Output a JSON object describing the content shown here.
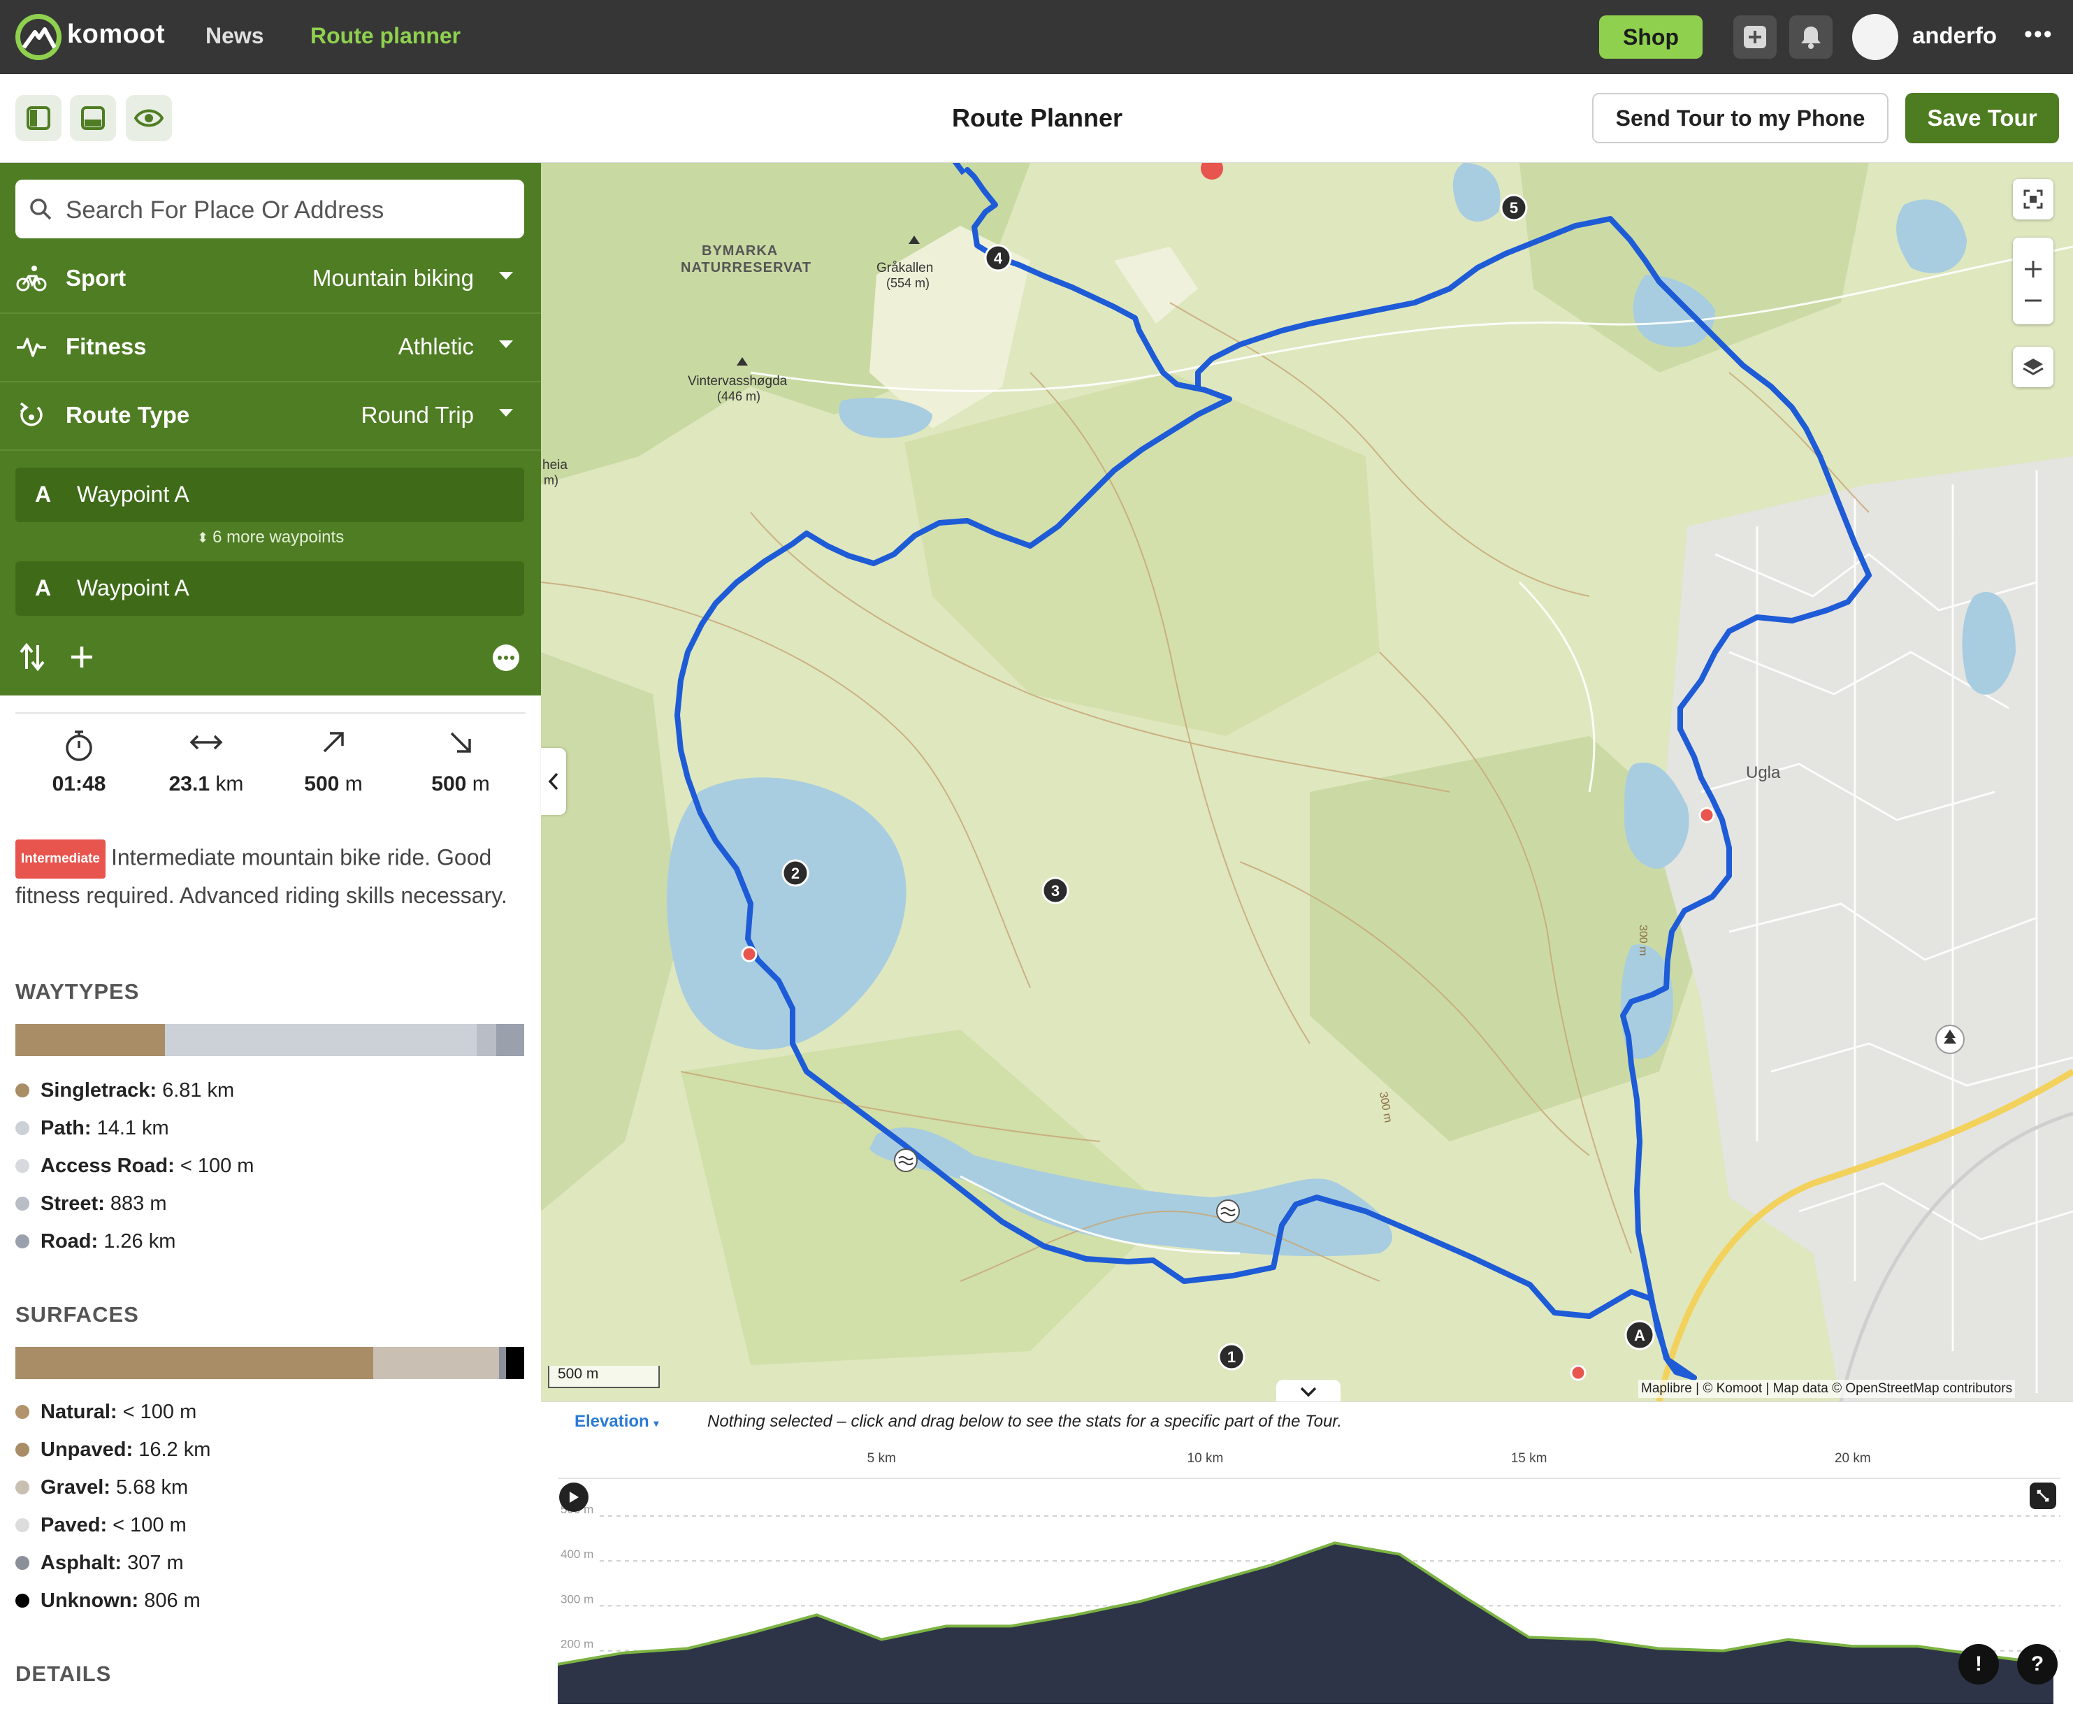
{
  "nav": {
    "brand": "komoot",
    "news": "News",
    "route_planner": "Route planner",
    "shop": "Shop",
    "username": "anderfo",
    "more": "•••"
  },
  "toolbar": {
    "title": "Route Planner",
    "send_tour": "Send Tour to my Phone",
    "save_tour": "Save Tour"
  },
  "sidebar": {
    "search_placeholder": "Search For Place Or Address",
    "sport": {
      "label": "Sport",
      "value": "Mountain biking"
    },
    "fitness": {
      "label": "Fitness",
      "value": "Athletic"
    },
    "route_type": {
      "label": "Route Type",
      "value": "Round Trip"
    },
    "waypoints": [
      {
        "letter": "A",
        "label": "Waypoint A"
      },
      {
        "letter": "A",
        "label": "Waypoint A"
      }
    ],
    "more_waypoints": "6 more waypoints",
    "stats": {
      "duration": "01:48",
      "distance_value": "23.1",
      "distance_unit": "km",
      "uphill_value": "500",
      "uphill_unit": "m",
      "downhill_value": "500",
      "downhill_unit": "m"
    },
    "difficulty_badge": "Intermediate",
    "description": "Intermediate mountain bike ride. Good fitness required. Advanced riding skills necessary.",
    "waytypes_heading": "WAYTYPES",
    "waytypes": [
      {
        "name": "Singletrack:",
        "value": "6.81 km",
        "color": "#a88d67",
        "share": 0.295
      },
      {
        "name": "Path:",
        "value": "14.1 km",
        "color": "#ccd0d7",
        "share": 0.61
      },
      {
        "name": "Access Road:",
        "value": "< 100 m",
        "color": "#d7d9de",
        "share": 0.0
      },
      {
        "name": "Street:",
        "value": "883 m",
        "color": "#b9bdc6",
        "share": 0.038
      },
      {
        "name": "Road:",
        "value": "1.26 km",
        "color": "#9aa0ac",
        "share": 0.055
      }
    ],
    "surfaces_heading": "SURFACES",
    "surfaces": [
      {
        "name": "Natural:",
        "value": "< 100 m",
        "color": "#b3936b",
        "share": 0.0
      },
      {
        "name": "Unpaved:",
        "value": "16.2 km",
        "color": "#a88d67",
        "share": 0.702
      },
      {
        "name": "Gravel:",
        "value": "5.68 km",
        "color": "#c9bfb2",
        "share": 0.246
      },
      {
        "name": "Paved:",
        "value": "< 100 m",
        "color": "#dcdcdc",
        "share": 0.0
      },
      {
        "name": "Asphalt:",
        "value": "307 m",
        "color": "#8a8f99",
        "share": 0.013
      },
      {
        "name": "Unknown:",
        "value": "806 m",
        "color": "#000000",
        "share": 0.035
      }
    ],
    "details_heading": "DETAILS"
  },
  "map": {
    "labels": {
      "bymarka": "BYMARKA",
      "naturreservat": "NATURRESERVAT",
      "grakallen": "Gråkallen",
      "grakallen_alt": "(554 m)",
      "vinter": "Vintervasshøgda",
      "vinter_alt": "(446 m)",
      "heia": "heia",
      "heia_alt": "m)",
      "ugla": "Ugla",
      "contour_a": "300 m",
      "contour_b": "300 m"
    },
    "waypoint_markers": [
      "1",
      "2",
      "3",
      "4",
      "5",
      "A"
    ],
    "scale": "500 m",
    "attribution": "Maplibre | © Komoot | Map data © OpenStreetMap contributors",
    "controls": [
      "fullscreen-icon",
      "zoom-in-icon",
      "zoom-out-icon",
      "layers-icon"
    ]
  },
  "elevation": {
    "dropdown": "Elevation",
    "message": "Nothing selected – click and drag below to see the stats for a specific part of the Tour.",
    "km_ticks": [
      "5 km",
      "10 km",
      "15 km",
      "20 km"
    ],
    "m_ticks": [
      "500 m",
      "400 m",
      "300 m",
      "200 m"
    ],
    "profile_km": [
      0,
      1,
      2,
      3,
      4,
      5,
      6,
      7,
      8,
      9,
      10,
      11,
      12,
      13,
      14,
      15,
      16,
      17,
      18,
      19,
      20,
      21,
      22,
      23.1
    ],
    "profile_m": [
      170,
      195,
      205,
      240,
      280,
      225,
      255,
      255,
      280,
      310,
      350,
      390,
      440,
      415,
      320,
      230,
      225,
      205,
      200,
      225,
      210,
      210,
      190,
      170
    ]
  },
  "colors": {
    "topbar": "#363636",
    "accent_green": "#8fd14f",
    "sidebar_green": "#4f7d23",
    "route_blue": "#1e5bd6",
    "save_green": "#4e7d21"
  }
}
